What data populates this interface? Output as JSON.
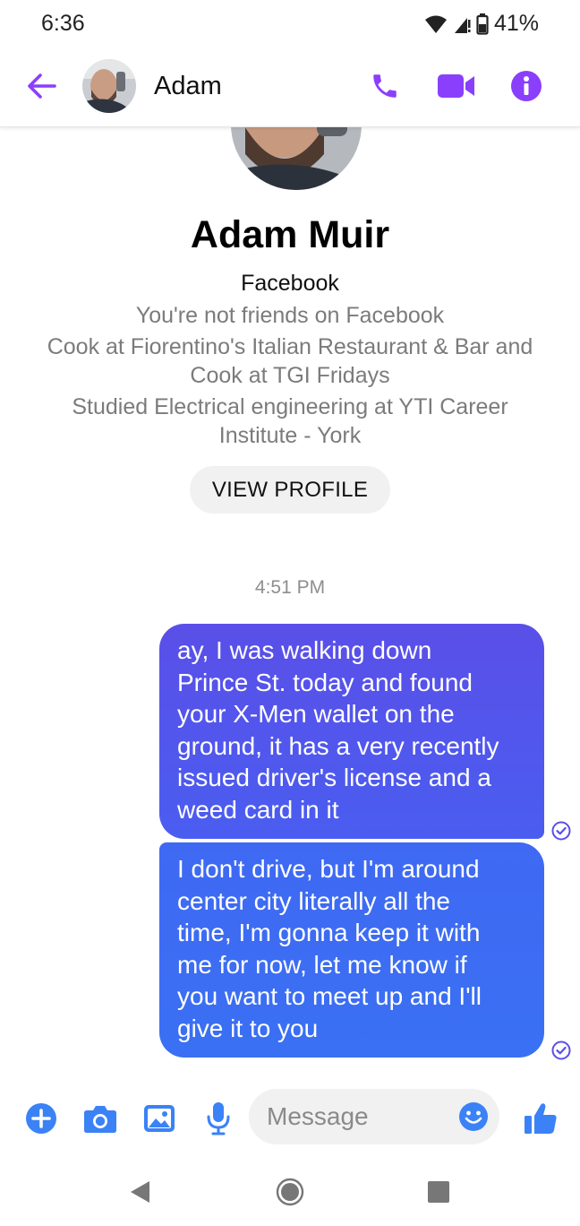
{
  "status_bar": {
    "time": "6:36",
    "battery": "41%"
  },
  "header": {
    "contact_name": "Adam"
  },
  "profile": {
    "full_name": "Adam Muir",
    "source": "Facebook",
    "friend_status": "You're not friends on Facebook",
    "work_line_1": "Cook at Fiorentino's Italian Restaurant & Bar and",
    "work_line_2": "Cook at TGI Fridays",
    "education_line_1": "Studied Electrical engineering at YTI Career",
    "education_line_2": "Institute - York",
    "view_profile_label": "VIEW PROFILE"
  },
  "conversation": {
    "timestamp": "4:51 PM",
    "messages": [
      {
        "lines": [
          "ay, I was walking down",
          "Prince St. today and found",
          "your X-Men wallet on the",
          "ground, it has a very recently",
          "issued driver's license and a",
          "weed card in it"
        ]
      },
      {
        "lines": [
          "I don't drive, but I'm around",
          "center city literally all the",
          "time, I'm gonna keep it with",
          "me for now, let me know if",
          "you want to meet up and I'll",
          "give it to you"
        ]
      }
    ]
  },
  "composer": {
    "placeholder": "Message"
  },
  "colors": {
    "accent_purple": "#8a3ffc",
    "composer_blue": "#3b82f6",
    "bubble_top": "#5a4fe8",
    "bubble_bottom": "#3a70f3"
  },
  "icons": {
    "back": "arrow-left-icon",
    "call": "phone-icon",
    "video": "video-camera-icon",
    "info": "info-icon",
    "add": "plus-circle-icon",
    "camera": "camera-icon",
    "gallery": "image-icon",
    "mic": "microphone-icon",
    "emoji": "smiley-icon",
    "like": "thumbs-up-icon"
  }
}
